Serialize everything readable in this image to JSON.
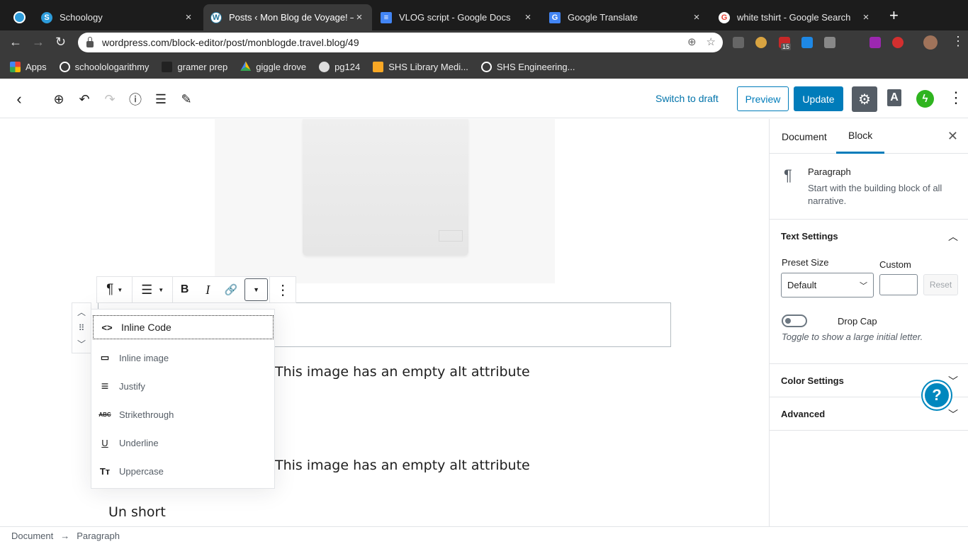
{
  "browser": {
    "tabs": [
      {
        "title": "Schoology",
        "icon": "schoology-icon",
        "color": "#2d9cdb"
      },
      {
        "title": "Posts ‹ Mon Blog de Voyage! —",
        "icon": "wordpress-icon",
        "color": "#21759b"
      },
      {
        "title": "VLOG script - Google Docs",
        "icon": "google-docs-icon",
        "color": "#4285f4"
      },
      {
        "title": "Google Translate",
        "icon": "google-translate-icon",
        "color": "#4285f4"
      },
      {
        "title": "white tshirt - Google Search",
        "icon": "google-icon",
        "color": "#ea4335"
      }
    ],
    "close_glyph": "×",
    "new_tab": "+",
    "url": "wordpress.com/block-editor/post/monblogde.travel.blog/49",
    "bookmarks": [
      {
        "label": "Apps",
        "icon": "apps-grid-icon"
      },
      {
        "label": "schoolologarithmy",
        "icon": "schoology-icon"
      },
      {
        "label": "gramer prep",
        "icon": "gb-icon"
      },
      {
        "label": "giggle drove",
        "icon": "google-drive-icon"
      },
      {
        "label": "pg124",
        "icon": "globe-icon"
      },
      {
        "label": "SHS Library Medi...",
        "icon": "library-icon"
      },
      {
        "label": "SHS Engineering...",
        "icon": "schoology-icon"
      }
    ],
    "ext_badge": "15"
  },
  "wp_toolbar": {
    "switch_to_draft": "Switch to draft",
    "preview": "Preview",
    "update": "Update",
    "a_label": "A"
  },
  "format_menu": {
    "items": [
      {
        "label": "Inline Code",
        "icon": "code-icon",
        "glyph": "<>"
      },
      {
        "label": "Inline image",
        "icon": "inline-image-icon",
        "glyph": "▭"
      },
      {
        "label": "Justify",
        "icon": "justify-icon",
        "glyph": "≡"
      },
      {
        "label": "Strikethrough",
        "icon": "strikethrough-icon",
        "glyph": "ABC"
      },
      {
        "label": "Underline",
        "icon": "underline-icon",
        "glyph": "U"
      },
      {
        "label": "Uppercase",
        "icon": "uppercase-icon",
        "glyph": "Tт"
      }
    ]
  },
  "content": {
    "caption_1": "This image has an empty alt attribute",
    "caption_2": "This image has an empty alt attribute",
    "paragraph_text": "Un short"
  },
  "sidebar": {
    "tab_document": "Document",
    "tab_block": "Block",
    "block_name": "Paragraph",
    "block_description": "Start with the building block of all narrative.",
    "text_settings": {
      "title": "Text Settings",
      "preset_label": "Preset Size",
      "custom_label": "Custom",
      "preset_value": "Default",
      "reset": "Reset",
      "drop_cap_label": "Drop Cap",
      "drop_cap_help": "Toggle to show a large initial letter."
    },
    "color_settings": "Color Settings",
    "advanced": "Advanced"
  },
  "footer": {
    "breadcrumb": [
      "Document",
      "Paragraph"
    ],
    "separator": "→"
  },
  "help_glyph": "?"
}
